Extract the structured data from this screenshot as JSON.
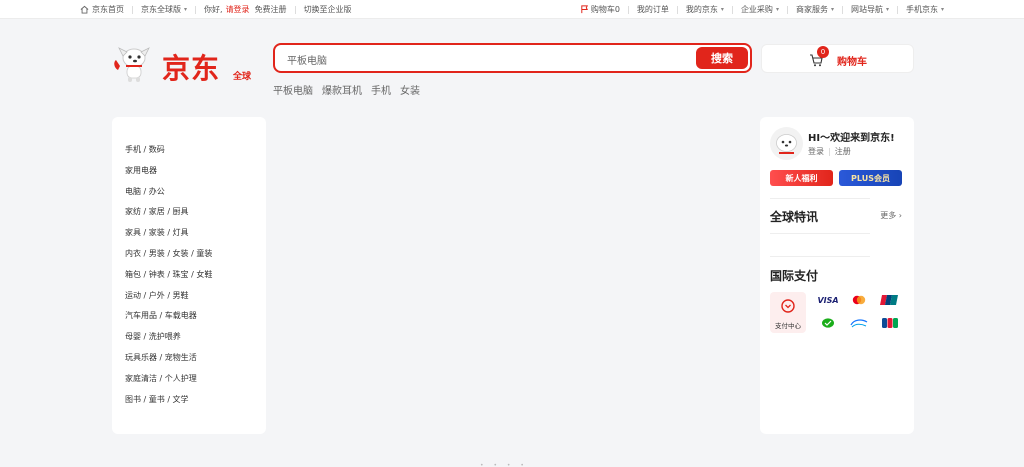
{
  "topbar": {
    "home": "京东首页",
    "global_site": "京东全球版",
    "greeting": "你好,",
    "login": "请登录",
    "register": "免费注册",
    "enterprise_switch": "切换至企业版",
    "cart": "购物车0",
    "orders": "我的订单",
    "my_jd": "我的京东",
    "enterprise_purchase": "企业采购",
    "merchant_service": "商家服务",
    "site_nav": "网站导航",
    "mobile_jd": "手机京东"
  },
  "logo": {
    "brand": "京东",
    "sub": "全球"
  },
  "search": {
    "value": "平板电脑",
    "button": "搜索",
    "hotwords": [
      "平板电脑",
      "爆款耳机",
      "手机",
      "女装"
    ]
  },
  "cart": {
    "count": "0",
    "label": "购物车"
  },
  "categories": [
    "手机 / 数码",
    "家用电器",
    "电脑 / 办公",
    "家纺 / 家居 / 厨具",
    "家具 / 家装 / 灯具",
    "内衣 / 男装 / 女装 / 童装",
    "箱包 / 钟表 / 珠宝 / 女鞋",
    "运动 / 户外 / 男鞋",
    "汽车用品 / 车载电器",
    "母婴 / 洗护喂养",
    "玩具乐器 / 宠物生活",
    "家庭清洁 / 个人护理",
    "图书 / 童书 / 文学"
  ],
  "user_panel": {
    "welcome": "HI～欢迎来到京东!",
    "login": "登录",
    "register": "注册",
    "new_user_btn": "新人福利",
    "plus_btn": "PLUS会员",
    "news_title": "全球特讯",
    "more": "更多",
    "payment_title": "国际支付",
    "pay_center": "支付中心",
    "visa_text": "VISA"
  },
  "colors": {
    "accent": "#e1251b",
    "plus": "#1744b6"
  }
}
